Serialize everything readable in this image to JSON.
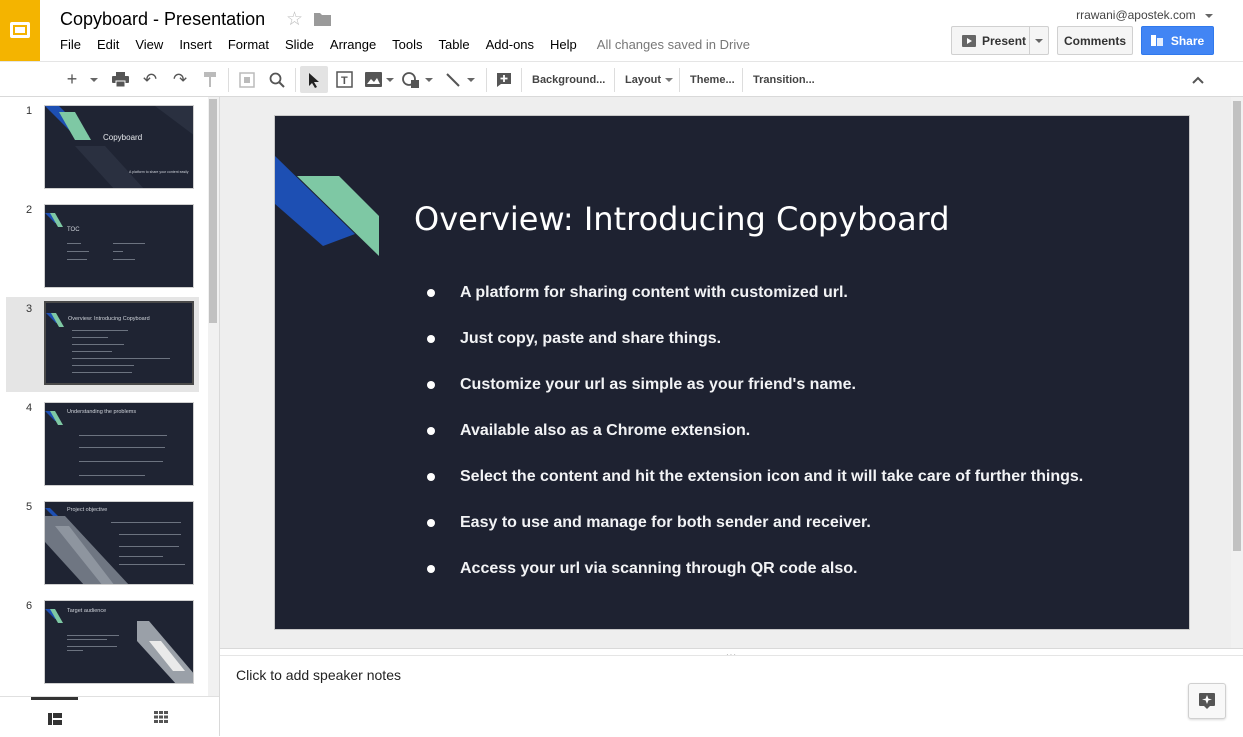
{
  "app": {
    "doc_title": "Copyboard - Presentation",
    "save_status": "All changes saved in Drive",
    "user_email": "rrawani@apostek.com"
  },
  "menu": [
    "File",
    "Edit",
    "View",
    "Insert",
    "Format",
    "Slide",
    "Arrange",
    "Tools",
    "Table",
    "Add-ons",
    "Help"
  ],
  "buttons": {
    "present": "Present",
    "comments": "Comments",
    "share": "Share"
  },
  "toolbar": {
    "background": "Background...",
    "layout": "Layout",
    "theme": "Theme...",
    "transition": "Transition..."
  },
  "slides": [
    {
      "num": "1",
      "title": "Copyboard",
      "subtitle": "A platform to share your content easily"
    },
    {
      "num": "2",
      "title": "TOC"
    },
    {
      "num": "3",
      "title": "Overview: Introducing Copyboard"
    },
    {
      "num": "4",
      "title": "Understanding the problems"
    },
    {
      "num": "5",
      "title": "Project objective"
    },
    {
      "num": "6",
      "title": "Target audience"
    }
  ],
  "current_slide": {
    "title": "Overview: Introducing Copyboard",
    "bullets": [
      "A platform for sharing content with customized url.",
      "Just copy, paste and share things.",
      "Customize your url as simple as  your friend's name.",
      "Available also as a Chrome extension.",
      "Select the content and hit the extension icon and it will take care of further things.",
      "Easy to use and manage for both sender and receiver.",
      "Access your url via scanning through QR code also."
    ]
  },
  "notes": {
    "placeholder": "Click to add speaker notes"
  },
  "colors": {
    "brand_yellow": "#f4b400",
    "slide_bg": "#1e2231",
    "accent_blue": "#1d4fb3",
    "accent_green": "#7ec8a4",
    "share_blue": "#4285f4"
  }
}
